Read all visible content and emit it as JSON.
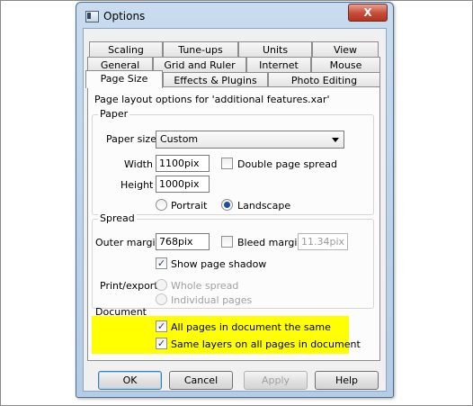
{
  "window": {
    "title": "Options",
    "close_glyph": "X",
    "icon": "options-app-icon"
  },
  "tabs": {
    "row1": [
      "Scaling",
      "Tune-ups",
      "Units",
      "View"
    ],
    "row2": [
      "General",
      "Grid and Ruler",
      "Internet",
      "Mouse"
    ],
    "row3": [
      "Page Size",
      "Effects & Plugins",
      "Photo Editing"
    ],
    "active": "Page Size"
  },
  "panel": {
    "intro": "Page layout options for 'additional features.xar'",
    "paper": {
      "group_label": "Paper",
      "paper_size_label": "Paper size",
      "paper_size_value": "Custom",
      "width_label": "Width",
      "width_value": "1100pix",
      "height_label": "Height",
      "height_value": "1000pix",
      "double_spread_label": "Double page spread",
      "double_spread_checked": false,
      "portrait_label": "Portrait",
      "landscape_label": "Landscape",
      "orientation": "Landscape"
    },
    "spread": {
      "group_label": "Spread",
      "outer_margin_label": "Outer margin",
      "outer_margin_value": "768pix",
      "bleed_margin_label": "Bleed margin",
      "bleed_margin_checked": false,
      "bleed_margin_value": "11.34pix",
      "show_shadow_label": "Show page shadow",
      "show_shadow_checked": true,
      "print_export_label": "Print/export",
      "whole_spread_label": "Whole spread",
      "individual_pages_label": "Individual pages"
    },
    "document": {
      "group_label": "Document",
      "all_pages_same_label": "All pages in document the same",
      "all_pages_same_checked": true,
      "same_layers_label": "Same layers on all pages in document",
      "same_layers_checked": true,
      "highlight_color": "#ffff00"
    }
  },
  "buttons": {
    "ok": "OK",
    "cancel": "Cancel",
    "apply": "Apply",
    "help": "Help"
  },
  "check_glyph": "✓"
}
